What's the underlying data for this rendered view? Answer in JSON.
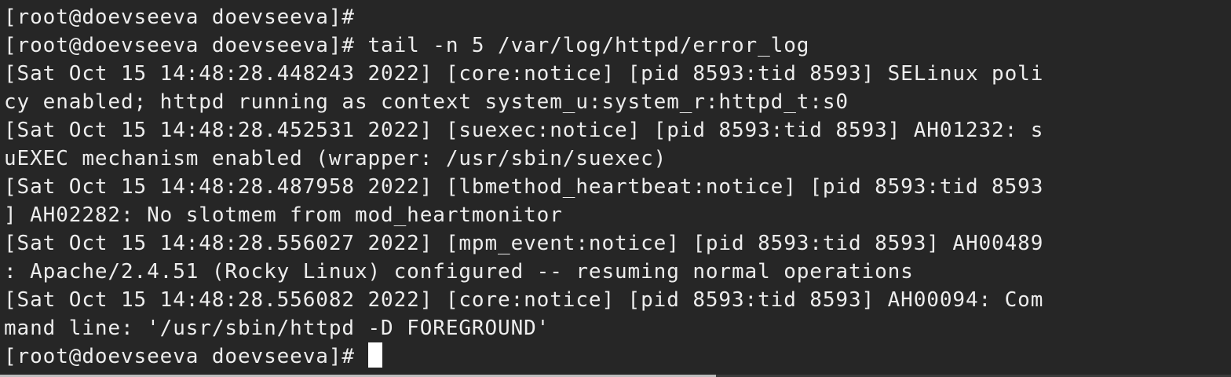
{
  "terminal": {
    "lines": [
      "[root@doevseeva doevseeva]#",
      "[root@doevseeva doevseeva]# tail -n 5 /var/log/httpd/error_log",
      "[Sat Oct 15 14:48:28.448243 2022] [core:notice] [pid 8593:tid 8593] SELinux poli",
      "cy enabled; httpd running as context system_u:system_r:httpd_t:s0",
      "[Sat Oct 15 14:48:28.452531 2022] [suexec:notice] [pid 8593:tid 8593] AH01232: s",
      "uEXEC mechanism enabled (wrapper: /usr/sbin/suexec)",
      "[Sat Oct 15 14:48:28.487958 2022] [lbmethod_heartbeat:notice] [pid 8593:tid 8593",
      "] AH02282: No slotmem from mod_heartmonitor",
      "[Sat Oct 15 14:48:28.556027 2022] [mpm_event:notice] [pid 8593:tid 8593] AH00489",
      ": Apache/2.4.51 (Rocky Linux) configured -- resuming normal operations",
      "[Sat Oct 15 14:48:28.556082 2022] [core:notice] [pid 8593:tid 8593] AH00094: Com",
      "mand line: '/usr/sbin/httpd -D FOREGROUND'"
    ],
    "prompt": "[root@doevseeva doevseeva]# ",
    "colors": {
      "background": "#262626",
      "foreground": "#ededed",
      "cursor": "#ffffff"
    }
  }
}
